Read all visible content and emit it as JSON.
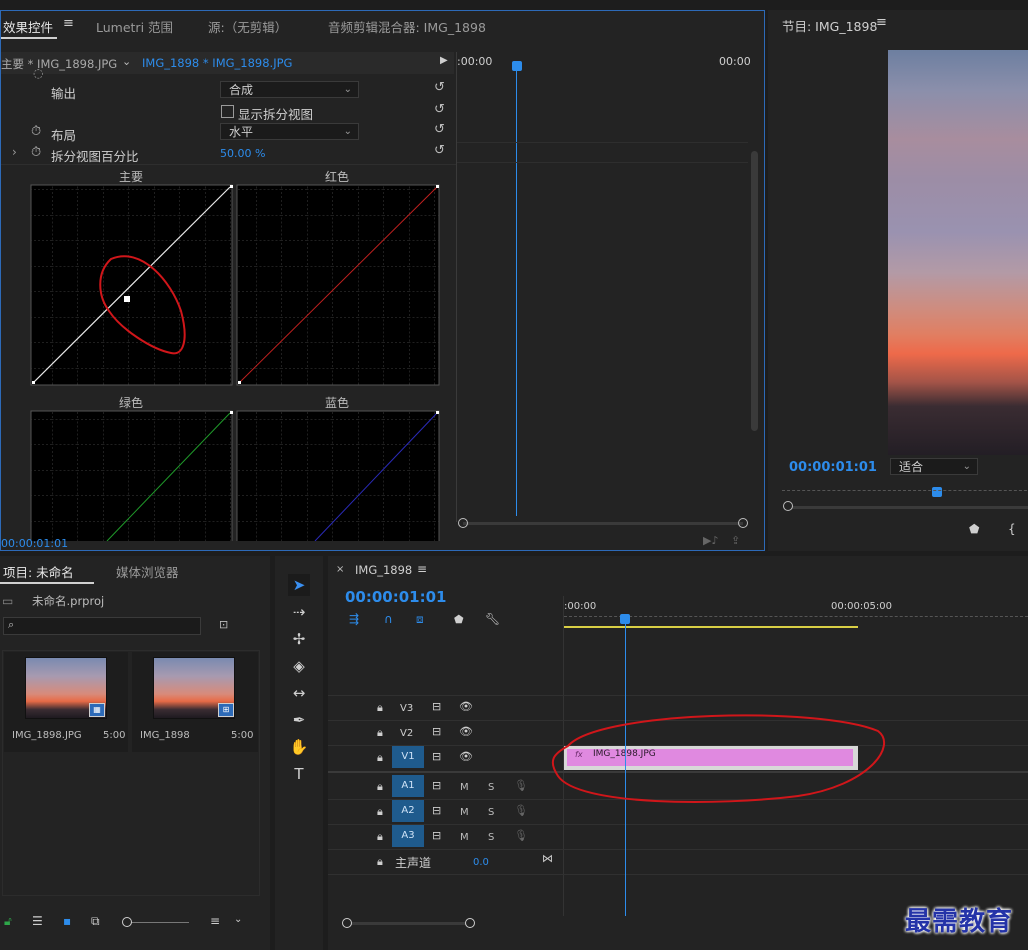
{
  "effects_panel": {
    "tabs": [
      "效果控件",
      "Lumetri 范围",
      "源:（无剪辑）",
      "音频剪辑混合器: IMG_1898"
    ],
    "menu_glyph": "≡",
    "breadcrumb_master": "主要 * IMG_1898.JPG",
    "breadcrumb_clip": "IMG_1898 * IMG_1898.JPG",
    "timecode_start": ":00:00",
    "timecode_end": "00:00",
    "rows": {
      "output_label": "输出",
      "output_value": "合成",
      "split_view_label": "显示拆分视图",
      "layout_label": "布局",
      "layout_value": "水平",
      "split_pct_label": "拆分视图百分比",
      "split_pct_value": "50.00 %"
    },
    "curves": {
      "master": "主要",
      "red": "红色",
      "green": "绿色",
      "blue": "蓝色"
    },
    "current_time": "00:00:01:01"
  },
  "program_monitor": {
    "title": "节目: IMG_1898",
    "timecode": "00:00:01:01",
    "fit_value": "适合"
  },
  "project_panel": {
    "tab_project": "项目: 未命名",
    "tab_media": "媒体浏览器",
    "file_name": "未命名.prproj",
    "search_placeholder": "",
    "items": [
      {
        "name": "IMG_1898.JPG",
        "duration": "5:00"
      },
      {
        "name": "IMG_1898",
        "duration": "5:00"
      }
    ]
  },
  "timeline": {
    "sequence_name": "IMG_1898",
    "timecode": "00:00:01:01",
    "ruler_start": ":00:00",
    "ruler_mark": "00:00:05:00",
    "video_tracks": [
      "V3",
      "V2",
      "V1"
    ],
    "audio_tracks": [
      "A1",
      "A2",
      "A3"
    ],
    "mute_label": "M",
    "solo_label": "S",
    "master_label": "主声道",
    "master_value": "0.0",
    "clip_label": "IMG_1898.JPG",
    "fx_label": "fx"
  },
  "watermark": "最需教育",
  "colors": {
    "accent_blue": "#2d8ceb",
    "clip_pink": "#e089e0",
    "annotation_red": "#d0161a"
  }
}
